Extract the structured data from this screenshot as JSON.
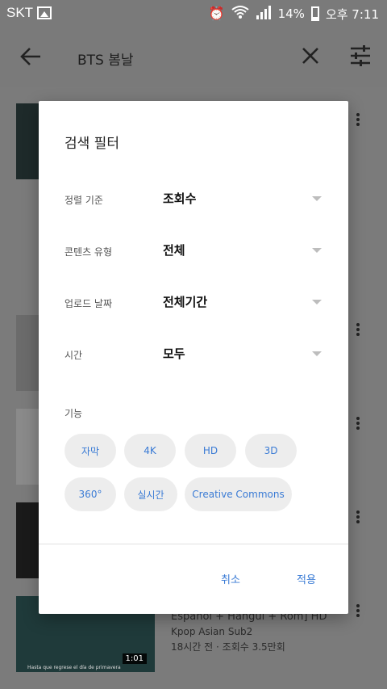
{
  "status_bar": {
    "carrier": "SKT",
    "battery": "14%",
    "time": "오후 7:11"
  },
  "app_bar": {
    "query": "BTS 봄날"
  },
  "results_visible": {
    "title_line": "Español + Hangul + Rom] HD",
    "channel": "Kpop Asian Sub2",
    "meta": "18시간 전 · 조회수 3.5만회",
    "duration": "1:01",
    "thumb_caption": "Hasta que regrese el día de primavera"
  },
  "dialog": {
    "title": "검색 필터",
    "filters": [
      {
        "label": "정렬 기준",
        "value": "조회수"
      },
      {
        "label": "콘텐츠 유형",
        "value": "전체"
      },
      {
        "label": "업로드 날짜",
        "value": "전체기간"
      },
      {
        "label": "시간",
        "value": "모두"
      }
    ],
    "features_label": "기능",
    "features": [
      "자막",
      "4K",
      "HD",
      "3D",
      "360°",
      "실시간",
      "Creative Commons"
    ],
    "cancel": "취소",
    "apply": "적용"
  },
  "colors": {
    "accent": "#3a7bd5",
    "scrim": "#7a7a7a"
  }
}
